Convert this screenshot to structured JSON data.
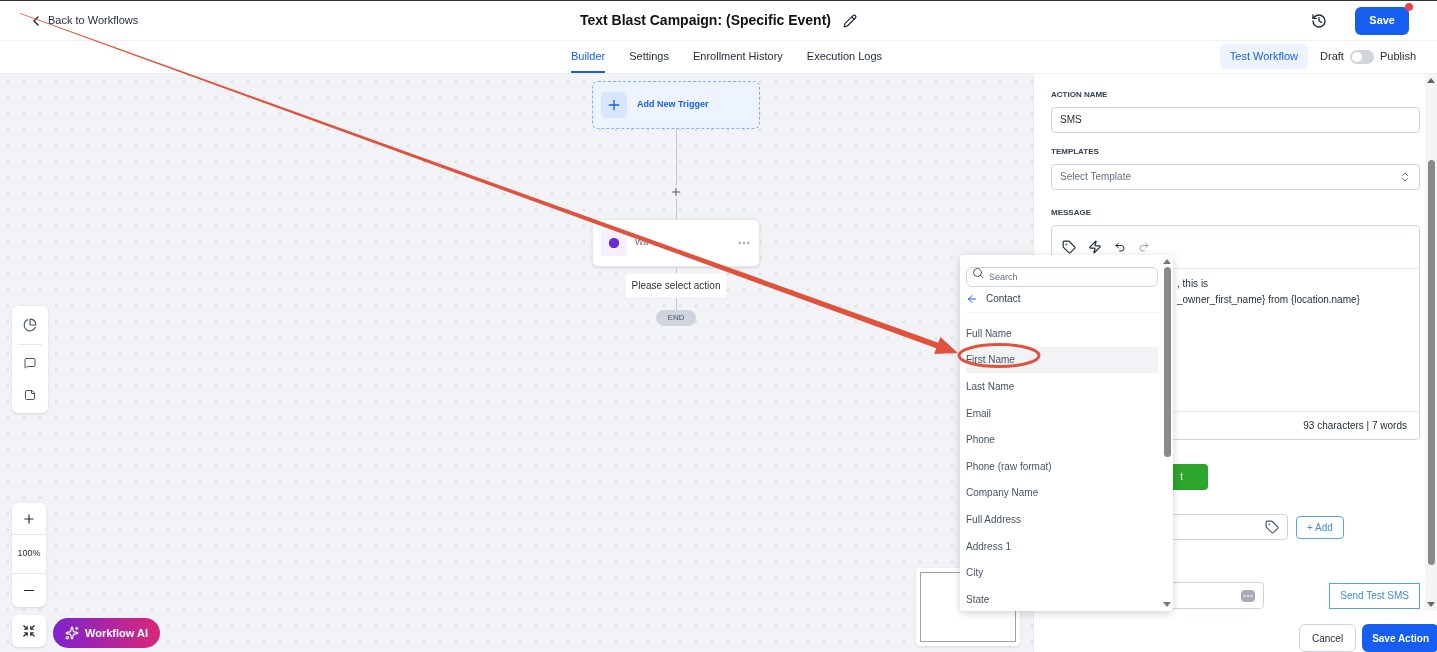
{
  "header": {
    "back_link": "Back to Workflows",
    "title": "Text Blast Campaign: (Specific Event)",
    "save_button": "Save",
    "notification": true
  },
  "tabs": [
    {
      "label": "Builder",
      "selected": true
    },
    {
      "label": "Settings",
      "selected": false
    },
    {
      "label": "Enrollment History",
      "selected": false
    },
    {
      "label": "Execution Logs",
      "selected": false
    }
  ],
  "test_workflow_button": "Test Workflow",
  "publish_toggle": {
    "off_label": "Draft",
    "on_label": "Publish",
    "on": false
  },
  "canvas": {
    "trigger": "Add New Trigger",
    "wait_node": "Wa",
    "action_placeholder": "Please select action",
    "end": "END",
    "zoom_level": "100%",
    "workflow_ai_button": "Workflow AI"
  },
  "panel": {
    "action_name": {
      "label": "ACTION NAME",
      "value": "SMS"
    },
    "templates": {
      "label": "TEMPLATES",
      "placeholder": "Select Template"
    },
    "message": {
      "label": "MESSAGE",
      "lines": [
        ", this is",
        "_owner_first_name} from {location.name}"
      ],
      "counter": "93 characters | 7 words"
    },
    "green_button": "t",
    "add_button": "+ Add",
    "send_test_button": "Send Test SMS",
    "cancel_button": "Cancel",
    "save_action_button": "Save Action"
  },
  "dropdown": {
    "search_placeholder": "Search",
    "back_label": "Contact",
    "items": [
      {
        "label": "Full Name",
        "selected": false
      },
      {
        "label": "First Name",
        "selected": true
      },
      {
        "label": "Last Name",
        "selected": false
      },
      {
        "label": "Email",
        "selected": false
      },
      {
        "label": "Phone",
        "selected": false
      },
      {
        "label": "Phone (raw format)",
        "selected": false
      },
      {
        "label": "Company Name",
        "selected": false
      },
      {
        "label": "Full Address",
        "selected": false
      },
      {
        "label": "Address 1",
        "selected": false
      },
      {
        "label": "City",
        "selected": false
      },
      {
        "label": "State",
        "selected": false
      }
    ]
  }
}
